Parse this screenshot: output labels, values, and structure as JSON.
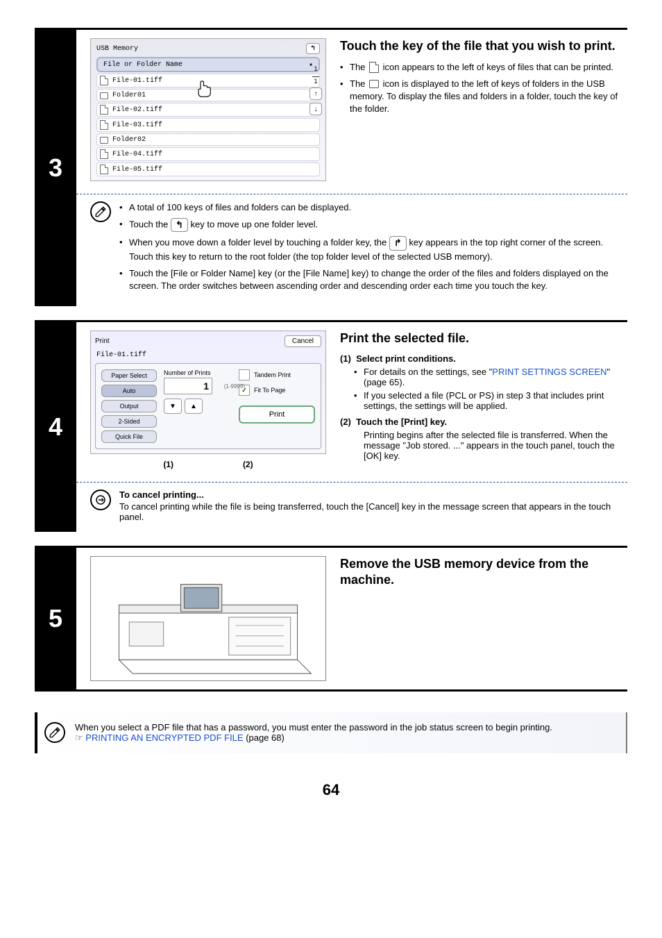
{
  "page_number": "64",
  "step3": {
    "num": "3",
    "screen": {
      "title": "USB Memory",
      "up_symbol": "↰",
      "header": "File or Folder Name",
      "sort_arrow": "▴",
      "rows": [
        {
          "type": "doc",
          "name": "File-01.tiff"
        },
        {
          "type": "folder",
          "name": "Folder01"
        },
        {
          "type": "doc",
          "name": "File-02.tiff"
        },
        {
          "type": "doc",
          "name": "File-03.tiff"
        },
        {
          "type": "folder",
          "name": "Folder02"
        },
        {
          "type": "doc",
          "name": "File-04.tiff"
        },
        {
          "type": "doc",
          "name": "File-05.tiff"
        }
      ],
      "page_ind_top": "1",
      "page_ind_bot": "1",
      "scroll_up": "↑",
      "scroll_down": "↓"
    },
    "heading": "Touch the key of the file that you wish to print.",
    "b1a": "The ",
    "b1b": " icon appears to the left of keys of files that can be printed.",
    "b2a": "The ",
    "b2b": " icon is displayed to the left of keys of folders in the USB memory. To display the files and folders in a folder, touch the key of the folder.",
    "note1": "A total of 100 keys of files and folders can be displayed.",
    "note2a": "Touch the ",
    "note2_key": "↰",
    "note2b": " key to move up one folder level.",
    "note3a": "When you move down a folder level by touching a folder key, the ",
    "note3_key": "↱",
    "note3b": " key appears in the top right corner of the screen. Touch this key to return to the root folder (the top folder level of the selected USB memory).",
    "note4": "Touch the [File or Folder Name] key (or the [File Name] key) to change the order of the files and folders displayed on the screen. The order switches between ascending order and descending order each time you touch the key."
  },
  "step4": {
    "num": "4",
    "screen": {
      "title": "Print",
      "cancel": "Cancel",
      "filename": "File-01.tiff",
      "paper_select": "Paper Select",
      "auto": "Auto",
      "output": "Output",
      "two_sided": "2-Sided",
      "quick_file": "Quick File",
      "num_label": "Number of Prints",
      "num_value": "1",
      "num_range": "(1-9999)",
      "down_arrow": "▼",
      "up_arrow": "▲",
      "check": "✓",
      "tandem": "Tandem Print",
      "fit": "Fit To Page",
      "print": "Print",
      "callout1": "(1)",
      "callout2": "(2)"
    },
    "heading": "Print the selected file.",
    "sub1_no": "(1)",
    "sub1_title": "Select print conditions.",
    "sub1_b1a": "For details on the settings, see \"",
    "sub1_b1_link": "PRINT SETTINGS SCREEN",
    "sub1_b1b": "\" (page 65).",
    "sub1_b2": "If you selected a file (PCL or PS) in step 3 that includes print settings, the settings will be applied.",
    "sub2_no": "(2)",
    "sub2_title": "Touch the [Print] key.",
    "sub2_body": "Printing begins after the selected file is transferred. When the message \"Job stored. ...\" appears in the touch panel, touch the [OK] key.",
    "cancel_heading": "To cancel printing...",
    "cancel_body": "To cancel printing while the file is being transferred, touch the [Cancel] key in the message screen that appears in the touch panel."
  },
  "step5": {
    "num": "5",
    "heading": "Remove the USB memory device from the machine."
  },
  "footer": {
    "line1": "When you select a PDF file that has a password, you must enter the password in the job status screen to begin printing.",
    "pointer": "☞",
    "link": "PRINTING AN ENCRYPTED PDF FILE",
    "after": " (page 68)"
  }
}
